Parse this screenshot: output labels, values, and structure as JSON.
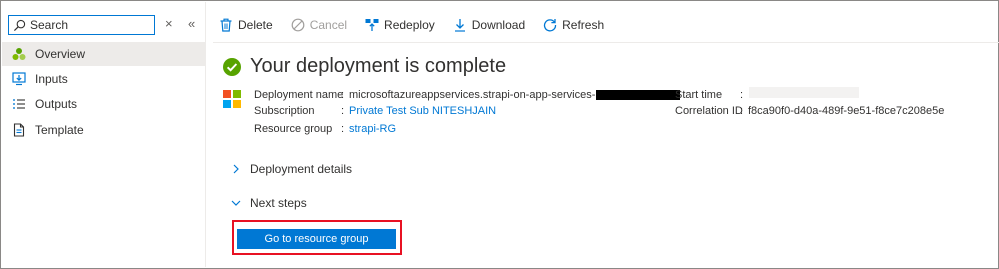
{
  "sidebar": {
    "search_placeholder": "Search",
    "clear_label": "×",
    "collapse_label": "«",
    "items": [
      {
        "label": "Overview",
        "icon": "overview-icon",
        "active": true
      },
      {
        "label": "Inputs",
        "icon": "inputs-icon"
      },
      {
        "label": "Outputs",
        "icon": "outputs-icon"
      },
      {
        "label": "Template",
        "icon": "template-icon"
      }
    ]
  },
  "toolbar": {
    "delete": "Delete",
    "cancel": "Cancel",
    "redeploy": "Redeploy",
    "download": "Download",
    "refresh": "Refresh"
  },
  "main": {
    "title": "Your deployment is complete",
    "deployment_name_label": "Deployment name",
    "deployment_name_value": "microsoftazureappservices.strapi-on-app-services-",
    "subscription_label": "Subscription",
    "subscription_value": "Private Test Sub NITESHJAIN",
    "resource_group_label": "Resource group",
    "resource_group_value": "strapi-RG",
    "start_time_label": "Start time",
    "correlation_id_label": "Correlation ID",
    "correlation_id_value": "f8ca90f0-d40a-489f-9e51-f8ce7c208e5e",
    "colon": ":",
    "deployment_details": "Deployment details",
    "next_steps": "Next steps",
    "go_button": "Go to resource group"
  },
  "colors": {
    "accent": "#0078d4",
    "success": "#57a300",
    "highlight": "#e81123"
  }
}
